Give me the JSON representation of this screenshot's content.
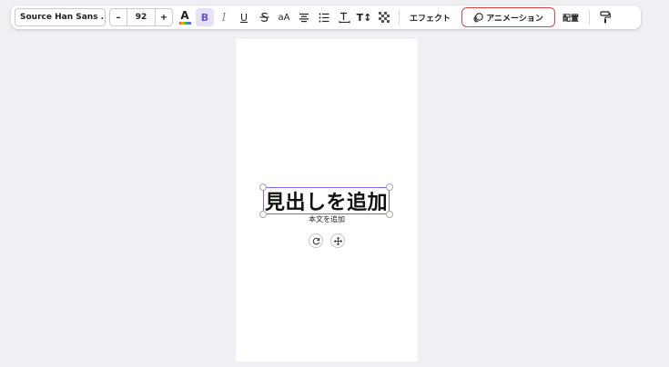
{
  "toolbar": {
    "font_family": "Source Han Sans ...",
    "decrease_label": "–",
    "font_size": "92",
    "increase_label": "+",
    "text_color_label": "A",
    "bold_label": "B",
    "italic_label": "I",
    "underline_label": "U",
    "strike_label": "S",
    "case_label": "aA",
    "spacing_label": "T↕",
    "effect_label": "エフェクト",
    "animation_label": "アニメーション",
    "layout_label": "配置"
  },
  "canvas": {
    "heading": "見出しを追加",
    "body": "本文を追加"
  },
  "colors": {
    "selection": "#8b5cf6",
    "bold_active_bg": "#e6e1fb",
    "animation_highlight": "#e0443e"
  }
}
